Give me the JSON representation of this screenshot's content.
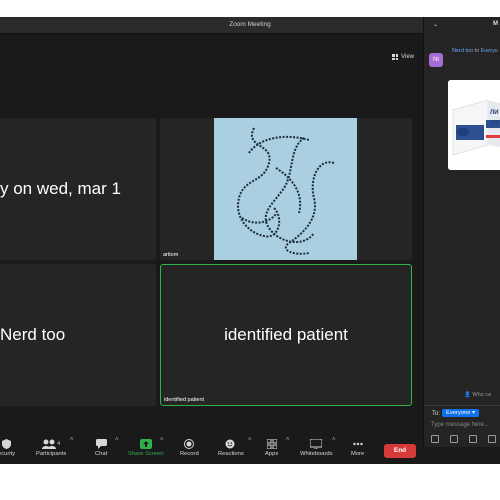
{
  "window": {
    "title": "Zoom Meeting"
  },
  "view_button": {
    "label": "View"
  },
  "tiles": {
    "top_left": {
      "text": "y on wed, mar 1"
    },
    "top_right": {
      "name": "artiom"
    },
    "bottom_left": {
      "text": "Nerd too"
    },
    "bottom_right": {
      "text": "identified patient",
      "name": "identified patient"
    }
  },
  "toolbar": {
    "security": "ecurity",
    "participants": "Participants",
    "participants_count": "4",
    "chat": "Chat",
    "share_screen": "Share Screen",
    "record": "Record",
    "reactions": "Reactions",
    "apps": "Apps",
    "whiteboards": "Whiteboards",
    "more": "More",
    "end": "End"
  },
  "chat": {
    "header": "M",
    "avatar_initials": "Nt",
    "sender": "Nerd too",
    "to_word": "to",
    "recipient": "Everyo",
    "image_text_1": "ЛИ",
    "image_text_2": "300",
    "who_can": "Who ca",
    "to_label": "To:",
    "to_selected": "Everyone",
    "input_placeholder": "Type message here..."
  },
  "colors": {
    "active_speaker": "#2fb24c",
    "share_screen": "#2fb24c",
    "end_button": "#d63939",
    "accent_blue": "#0e71eb"
  }
}
